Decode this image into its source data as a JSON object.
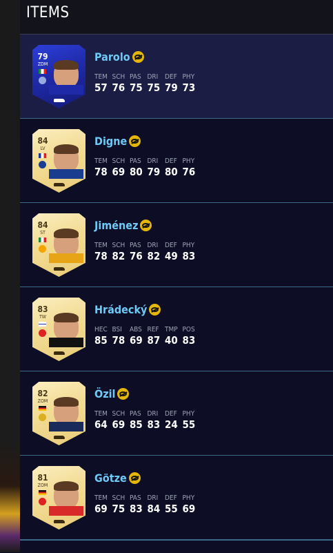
{
  "header": {
    "title": "ITEMS"
  },
  "colors": {
    "accent_name": "#6ec9f5",
    "chemistry": "#e5b60a",
    "divider": "#3c6a88"
  },
  "items": [
    {
      "name": "Parolo",
      "rating": "79",
      "position": "ZDM",
      "card": "tots",
      "stats": [
        [
          "TEM",
          "57"
        ],
        [
          "SCH",
          "76"
        ],
        [
          "PAS",
          "75"
        ],
        [
          "DRI",
          "75"
        ],
        [
          "DEF",
          "79"
        ],
        [
          "PHY",
          "73"
        ]
      ]
    },
    {
      "name": "Digne",
      "rating": "84",
      "position": "LV",
      "card": "gold",
      "stats": [
        [
          "TEM",
          "78"
        ],
        [
          "SCH",
          "69"
        ],
        [
          "PAS",
          "80"
        ],
        [
          "DRI",
          "79"
        ],
        [
          "DEF",
          "80"
        ],
        [
          "PHY",
          "76"
        ]
      ]
    },
    {
      "name": "Jiménez",
      "rating": "84",
      "position": "ST",
      "card": "gold",
      "stats": [
        [
          "TEM",
          "78"
        ],
        [
          "SCH",
          "82"
        ],
        [
          "PAS",
          "76"
        ],
        [
          "DRI",
          "82"
        ],
        [
          "DEF",
          "49"
        ],
        [
          "PHY",
          "83"
        ]
      ]
    },
    {
      "name": "Hrádecký",
      "rating": "83",
      "position": "TW",
      "card": "gold",
      "stats": [
        [
          "HEC",
          "85"
        ],
        [
          "BSI",
          "78"
        ],
        [
          "ABS",
          "69"
        ],
        [
          "REF",
          "87"
        ],
        [
          "TMP",
          "40"
        ],
        [
          "POS",
          "83"
        ]
      ]
    },
    {
      "name": "Özil",
      "rating": "82",
      "position": "ZOM",
      "card": "gold",
      "stats": [
        [
          "TEM",
          "64"
        ],
        [
          "SCH",
          "69"
        ],
        [
          "PAS",
          "85"
        ],
        [
          "DRI",
          "83"
        ],
        [
          "DEF",
          "24"
        ],
        [
          "PHY",
          "55"
        ]
      ]
    },
    {
      "name": "Götze",
      "rating": "81",
      "position": "ZOM",
      "card": "gold",
      "stats": [
        [
          "TEM",
          "69"
        ],
        [
          "SCH",
          "75"
        ],
        [
          "PAS",
          "83"
        ],
        [
          "DRI",
          "84"
        ],
        [
          "DEF",
          "55"
        ],
        [
          "PHY",
          "69"
        ]
      ]
    }
  ]
}
